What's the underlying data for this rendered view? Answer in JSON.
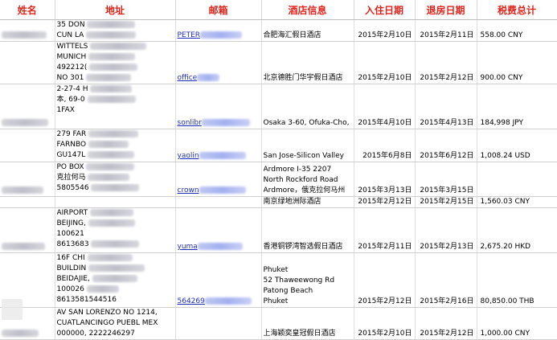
{
  "headers": [
    "姓名",
    "地址",
    "邮箱",
    "酒店信息",
    "入住日期",
    "退房日期",
    "税费总计"
  ],
  "rows": [
    {
      "address": [
        "35 DON",
        "CUN LA"
      ],
      "email": "PETER",
      "hotel": [
        "合肥海汇假日酒店"
      ],
      "checkin": "2015年2月10日",
      "checkout": "2015年2月11日",
      "tax": "558.00  CNY"
    },
    {
      "address": [
        "WITTELS",
        "MUNICH",
        "492212(",
        "NO 301"
      ],
      "email": "office",
      "hotel": [
        "北京德胜门华宇假日酒店"
      ],
      "checkin": "2015年2月10日",
      "checkout": "2015年2月12日",
      "tax": "900.00  CNY"
    },
    {
      "address": [
        "2-27-4 H",
        "本, 69-0",
        "1FAX"
      ],
      "email": "sonlibr",
      "hotel": [
        "Osaka 3-60, Ofuka-Cho, K"
      ],
      "checkin": "2015年4月10日",
      "checkout": "2015年4月13日",
      "tax": "184,998  JPY"
    },
    {
      "address": [
        "279 FAR",
        "FARNBO",
        "GU147L"
      ],
      "email": "yaolin",
      "hotel": [
        "San Jose-Silicon Valley"
      ],
      "checkin": "2015年6月8日",
      "checkout": "2015年6月12日",
      "tax": "1,008.24  USD"
    },
    {
      "address": [
        "PO BOX",
        "克拉何马",
        "5805546"
      ],
      "email": "crown",
      "hotel": [
        "Ardmore I-35 2207",
        "North Rockford Road",
        "Ardmore，俄克拉何马州"
      ],
      "checkin": "2015年3月13日",
      "checkout": "2015年3月15日",
      "tax": ""
    },
    {
      "address": [],
      "email": "",
      "hotel": [
        "南京绿地洲际酒店"
      ],
      "checkin": "2015年2月12日",
      "checkout": "2015年2月15日",
      "tax": "1,560.03  CNY"
    },
    {
      "address": [
        "AIRPORT",
        "BEIJING,",
        "100621",
        "8613683"
      ],
      "email": "yuma",
      "hotel": [
        "香港铜锣湾智选假日酒店"
      ],
      "checkin": "2015年2月11日",
      "checkout": "2015年2月13日",
      "tax": "2,675.20  HKD"
    },
    {
      "address": [
        "16F CHI",
        "BUILDIN",
        "BEIDAJIE,",
        "100026",
        "8613581544516"
      ],
      "email": "564269",
      "hotel": [
        "Phuket",
        "52 Thaweewong Rd",
        "Patong Beach",
        "Phuket"
      ],
      "checkin": "2015年2月12日",
      "checkout": "2015年2月16日",
      "tax": "80,850.00  THB"
    },
    {
      "address": [
        "AV SAN LORENZO NO 1214,",
        "CUATLANCINGO PUEBL MEX",
        "000000,  2222246297"
      ],
      "email": "",
      "hotel": [
        "上海颖奕皇冠假日酒店"
      ],
      "checkin": "2015年2月10日",
      "checkout": "2015年2月12日",
      "tax": "1,000.00  CNY"
    }
  ],
  "colors": {
    "header_text": "#e2231a",
    "link": "#1f2dbb",
    "grid": "#cfcfcf"
  }
}
